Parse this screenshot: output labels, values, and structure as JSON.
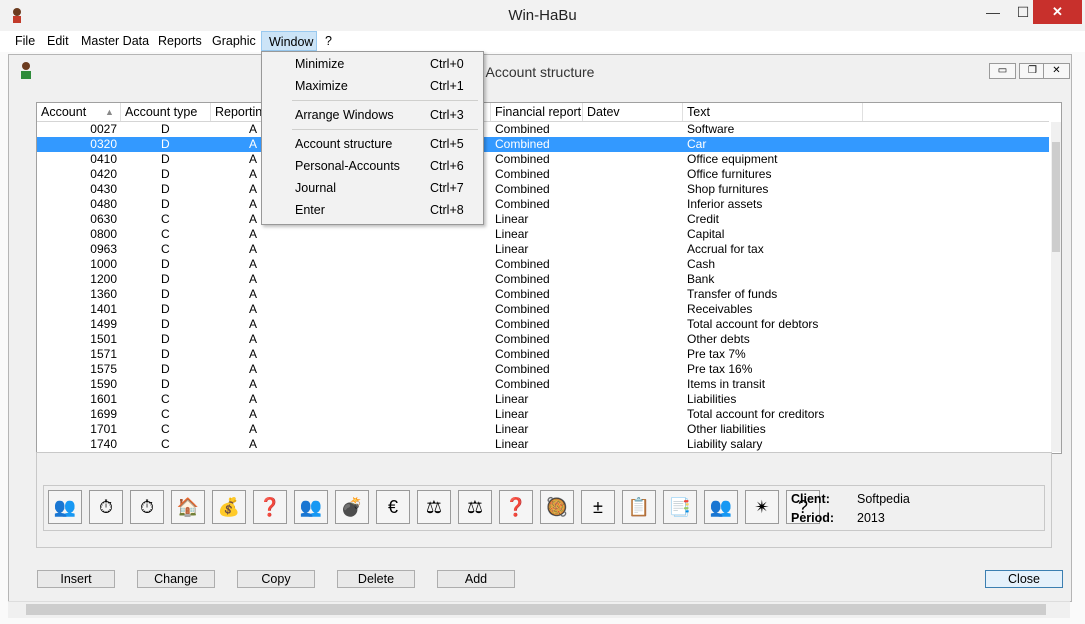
{
  "window": {
    "title": "Win-HaBu",
    "minimize": "—",
    "maximize": "☐",
    "close": "✕"
  },
  "menu": [
    {
      "label": "File"
    },
    {
      "label": "Edit"
    },
    {
      "label": "Master Data"
    },
    {
      "label": "Reports"
    },
    {
      "label": "Graphic"
    },
    {
      "label": "Window"
    },
    {
      "label": "?"
    }
  ],
  "child_window": {
    "title": "Account structure",
    "minimize": "▭",
    "restore": "❐",
    "close": "✕"
  },
  "dropdown": [
    {
      "label": "Minimize",
      "shortcut": "Ctrl+0"
    },
    {
      "label": "Maximize",
      "shortcut": "Ctrl+1"
    },
    {
      "label": "Arrange Windows",
      "shortcut": "Ctrl+3"
    },
    {
      "label": "Account structure",
      "shortcut": "Ctrl+5"
    },
    {
      "label": "Personal-Accounts",
      "shortcut": "Ctrl+6"
    },
    {
      "label": "Journal",
      "shortcut": "Ctrl+7"
    },
    {
      "label": "Enter",
      "shortcut": "Ctrl+8"
    }
  ],
  "grid": {
    "columns": [
      "Account",
      "Account type",
      "Reporting",
      "Financial report",
      "Datev",
      "Text"
    ],
    "rows": [
      [
        "0027",
        "D",
        "A",
        "Combined",
        "Software"
      ],
      [
        "0320",
        "D",
        "A",
        "Combined",
        "Car"
      ],
      [
        "0410",
        "D",
        "A",
        "Combined",
        "Office equipment"
      ],
      [
        "0420",
        "D",
        "A",
        "Combined",
        "Office furnitures"
      ],
      [
        "0430",
        "D",
        "A",
        "Combined",
        "Shop furnitures"
      ],
      [
        "0480",
        "D",
        "A",
        "Combined",
        "Inferior assets"
      ],
      [
        "0630",
        "C",
        "A",
        "Linear",
        "Credit"
      ],
      [
        "0800",
        "C",
        "A",
        "Linear",
        "Capital"
      ],
      [
        "0963",
        "C",
        "A",
        "Linear",
        "Accrual for tax"
      ],
      [
        "1000",
        "D",
        "A",
        "Combined",
        "Cash"
      ],
      [
        "1200",
        "D",
        "A",
        "Combined",
        "Bank"
      ],
      [
        "1360",
        "D",
        "A",
        "Combined",
        "Transfer of funds"
      ],
      [
        "1401",
        "D",
        "A",
        "Combined",
        "Receivables"
      ],
      [
        "1499",
        "D",
        "A",
        "Combined",
        "Total account for debtors"
      ],
      [
        "1501",
        "D",
        "A",
        "Combined",
        "Other debts"
      ],
      [
        "1571",
        "D",
        "A",
        "Combined",
        "Pre tax 7%"
      ],
      [
        "1575",
        "D",
        "A",
        "Combined",
        "Pre tax 16%"
      ],
      [
        "1590",
        "D",
        "A",
        "Combined",
        "Items in transit"
      ],
      [
        "1601",
        "C",
        "A",
        "Linear",
        "Liabilities"
      ],
      [
        "1699",
        "C",
        "A",
        "Linear",
        "Total account for creditors"
      ],
      [
        "1701",
        "C",
        "A",
        "Linear",
        "Other liabilities"
      ],
      [
        "1740",
        "C",
        "A",
        "Linear",
        "Liability salary"
      ]
    ]
  },
  "toolbar": {
    "icons": [
      "👥",
      "⏱",
      "⏱",
      "🏠",
      "💰",
      "❓",
      "👥",
      "💣",
      "€",
      "⚖",
      "⚖",
      "❓",
      "🥘",
      "±",
      "📋",
      "📑",
      "👥",
      "✴",
      "?"
    ],
    "client_label": "Client:",
    "client_value": "Softpedia",
    "period_label": "Period:",
    "period_value": "2013"
  },
  "buttons": {
    "insert": "Insert",
    "change": "Change",
    "copy": "Copy",
    "delete": "Delete",
    "add": "Add",
    "close": "Close"
  }
}
